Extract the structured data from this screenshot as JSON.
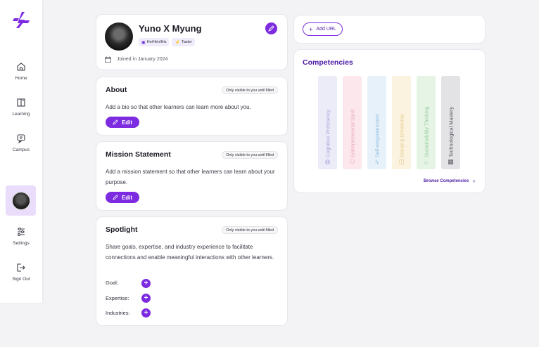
{
  "nav": {
    "items": [
      {
        "label": "Home",
        "icon": "home-icon"
      },
      {
        "label": "Learning",
        "icon": "book-icon"
      },
      {
        "label": "Campus",
        "icon": "campus-icon"
      },
      {
        "label": "Settings",
        "icon": "sliders-icon"
      },
      {
        "label": "Sign Out",
        "icon": "sign-out-icon"
      }
    ]
  },
  "profile": {
    "name": "Yuno X Myung",
    "pronouns": "He/Him/His",
    "role": "Taster",
    "joined": "Joined in January 2024"
  },
  "about": {
    "title": "About",
    "visibility": "Only visible to you until filled",
    "body": "Add a bio so that other learners can learn more about you.",
    "edit_label": "Edit"
  },
  "mission": {
    "title": "Mission Statement",
    "visibility": "Only visible to you until filled",
    "body": "Add a mission statement so that other learners can learn about your purpose.",
    "edit_label": "Edit"
  },
  "spotlight": {
    "title": "Spotlight",
    "visibility": "Only visible to you until filled",
    "body": "Share goals, expertise, and industry experience to facilitate connections and enable meaningful interactions with other learners.",
    "goal_label": "Goal:",
    "expertise_label": "Expertise:",
    "industries_label": "Industries:"
  },
  "url": {
    "add_label": "Add URL"
  },
  "competencies": {
    "title": "Competencies",
    "browse_label": "Browse Competencies",
    "items": [
      {
        "label": "Cognitive Proficiency",
        "bg": "#ecebf8",
        "color": "#a9a6db",
        "icon": "globe-icon"
      },
      {
        "label": "Entrepreneurial Spirit",
        "bg": "#fbe7ec",
        "color": "#e8a8b6",
        "icon": "people-icon"
      },
      {
        "label": "Self-empowerment",
        "bg": "#e6f1fa",
        "color": "#8fbedf",
        "icon": "bolt-icon"
      },
      {
        "label": "Social & Emotional",
        "bg": "#fbf3df",
        "color": "#e6c98b",
        "icon": "chat-icon"
      },
      {
        "label": "Sustainability Thinking",
        "bg": "#e6f4e6",
        "color": "#97cc9a",
        "icon": "sun-icon"
      },
      {
        "label": "Technological Mastery",
        "bg": "#e3e3e6",
        "color": "#5c5c64",
        "icon": "chip-icon"
      }
    ]
  },
  "colors": {
    "accent": "#7c2be0",
    "accent_dark": "#4b1aa5",
    "background": "#f3f3f6"
  }
}
